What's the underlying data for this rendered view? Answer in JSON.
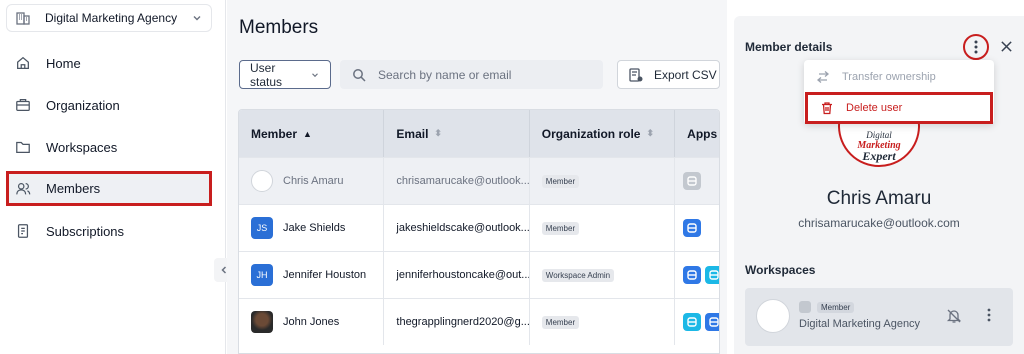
{
  "sidebar": {
    "org_name": "Digital Marketing Agency",
    "items": [
      {
        "label": "Home",
        "icon": "home-icon"
      },
      {
        "label": "Organization",
        "icon": "briefcase-icon"
      },
      {
        "label": "Workspaces",
        "icon": "folder-icon"
      },
      {
        "label": "Members",
        "icon": "users-icon",
        "active": true
      },
      {
        "label": "Subscriptions",
        "icon": "receipt-icon"
      }
    ]
  },
  "main": {
    "title": "Members",
    "status_filter": "User status",
    "search_placeholder": "Search by name or email",
    "export_label": "Export CSV",
    "table": {
      "headers": [
        "Member",
        "Email",
        "Organization role",
        "Apps"
      ],
      "rows": [
        {
          "avatar": "logo",
          "initials": "",
          "name": "Chris Amaru",
          "email": "chrisamarucake@outlook...",
          "role": "Member",
          "apps": [
            "gray"
          ]
        },
        {
          "avatar": "blue",
          "initials": "JS",
          "name": "Jake Shields",
          "email": "jakeshieldscake@outlook...",
          "role": "Member",
          "apps": [
            "blue"
          ]
        },
        {
          "avatar": "blue",
          "initials": "JH",
          "name": "Jennifer Houston",
          "email": "jenniferhoustoncake@out...",
          "role": "Workspace Admin",
          "apps": [
            "blue",
            "cyan"
          ]
        },
        {
          "avatar": "photo",
          "initials": "",
          "name": "John Jones",
          "email": "thegrapplingnerd2020@g...",
          "role": "Member",
          "apps": [
            "cyan",
            "blue"
          ]
        }
      ]
    }
  },
  "panel": {
    "title": "Member details",
    "menu": {
      "transfer_label": "Transfer ownership",
      "delete_label": "Delete user"
    },
    "member_name": "Chris Amaru",
    "member_email": "chrisamarucake@outlook.com",
    "logo_text": [
      "Digital",
      "Marketing",
      "Expert"
    ],
    "workspaces_title": "Workspaces",
    "workspace": {
      "role": "Member",
      "name": "Digital Marketing Agency"
    }
  },
  "colors": {
    "accent": "#2f78e6",
    "highlight": "#c81e1e",
    "app_cyan": "#1cb8e6"
  }
}
